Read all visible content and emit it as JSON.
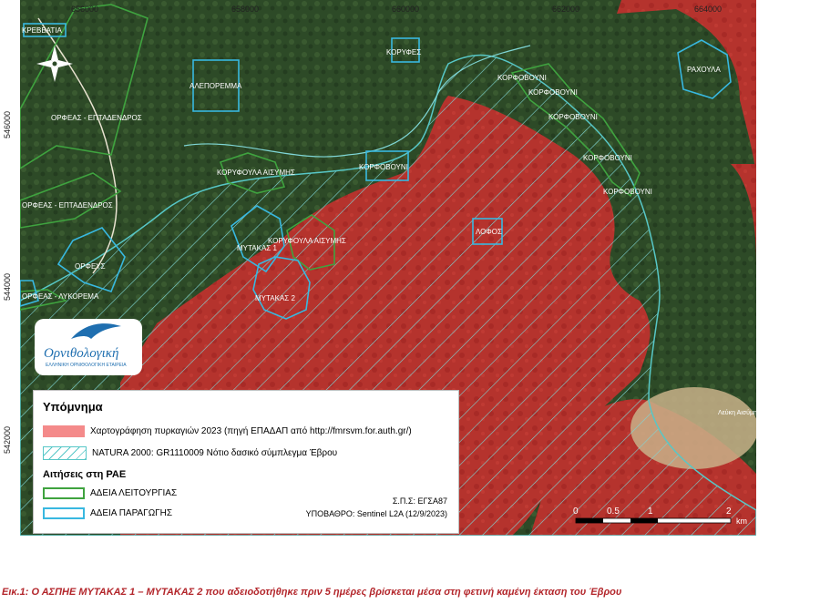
{
  "map": {
    "x_coords": [
      "656000",
      "658000",
      "660000",
      "662000",
      "664000"
    ],
    "y_coords": [
      "546000",
      "544000",
      "542000"
    ],
    "places": [
      {
        "name": "ΚΡΕΒΒΑΤΙΑ",
        "type": "natura"
      },
      {
        "name": "ΚΟΡΥΦΕΣ",
        "type": "blue"
      },
      {
        "name": "ΑΛΕΠΟΡΕΜΜΑ",
        "type": "blue"
      },
      {
        "name": "ΡΑΧΟΥΛΑ",
        "type": "blue"
      },
      {
        "name": "ΚΟΡΦΟΒΟΥΝΙ",
        "type": "green"
      },
      {
        "name": "ΚΟΡΦΟΒΟΥΝΙ",
        "type": "green"
      },
      {
        "name": "ΚΟΡΦΟΒΟΥΝΙ",
        "type": "green"
      },
      {
        "name": "ΚΟΡΦΟΒΟΥΝΙ",
        "type": "green"
      },
      {
        "name": "ΚΟΡΦΟΒΟΥΝΙ",
        "type": "green"
      },
      {
        "name": "ΚΟΡΦΟΒΟΥΝΙ",
        "type": "blue"
      },
      {
        "name": "ΟΡΦΕΑΣ - ΕΠΤΑΔΕΝΔΡΟΣ",
        "type": "green"
      },
      {
        "name": "ΟΡΦΕΑΣ - ΕΠΤΑΔΕΝΔΡΟΣ",
        "type": "green"
      },
      {
        "name": "ΚΟΡΥΦΟΥΛΑ ΑΙΣΥΜΗΣ",
        "type": "green"
      },
      {
        "name": "ΚΟΡΥΦΟΥΛΑ ΑΙΣΥΜΗΣ",
        "type": "green"
      },
      {
        "name": "ΜΥΤΑΚΑΣ 1",
        "type": "blue"
      },
      {
        "name": "ΜΥΤΑΚΑΣ 2",
        "type": "blue"
      },
      {
        "name": "ΛΟΦΟΣ",
        "type": "blue"
      },
      {
        "name": "ΟΡΦΕΥΣ",
        "type": "blue"
      },
      {
        "name": "ΟΡΦΕΑΣ - ΛΥΚΟΡΕΜΑ",
        "type": "green"
      },
      {
        "name": "Λεύκη Αισύμη",
        "type": "settlement"
      }
    ]
  },
  "logo": {
    "name": "Ορνιθολογική",
    "subtitle": "ΕΛΛΗΝΙΚΗ ΟΡΝΙΘΟΛΟΓΙΚΗ ΕΤΑΙΡΕΙΑ"
  },
  "legend": {
    "title": "Υπόμνημα",
    "fire": "Χαρτογράφηση πυρκαγιών 2023 (πηγή ΕΠΑΔΑΠ από http://fmrsvm.for.auth.gr/)",
    "natura": "NATURA 2000: GR1110009 Νότιο δασικό σύμπλεγμα Έβρου",
    "applications_title": "Αιτήσεις στη ΡΑΕ",
    "operation_license": "ΑΔΕΙΑ ΛΕΙΤΟΥΡΓΙΑΣ",
    "production_license": "ΑΔΕΙΑ ΠΑΡΑΓΩΓΗΣ",
    "crs": "Σ.Π.Σ: ΕΓΣΑ87",
    "basemap": "ΥΠΟΒΑΘΡΟ: Sentinel L2A (12/9/2023)"
  },
  "scale": {
    "labels": [
      "0",
      "0.5",
      "1",
      "2"
    ],
    "unit": "km"
  },
  "caption": "Εικ.1: Ο ΑΣΠΗΕ ΜΥΤΑΚΑΣ 1 – ΜΥΤΑΚΑΣ 2 που αδειοδοτήθηκε πριν 5 ημέρες βρίσκεται μέσα στη φετινή καμένη έκταση του Έβρου",
  "colors": {
    "forest": "#2f4f2a",
    "burned": "#b8302c",
    "natura": "#57c7c7",
    "operation": "#3fa33f",
    "production": "#38b8e0",
    "caption": "#b3262b"
  }
}
